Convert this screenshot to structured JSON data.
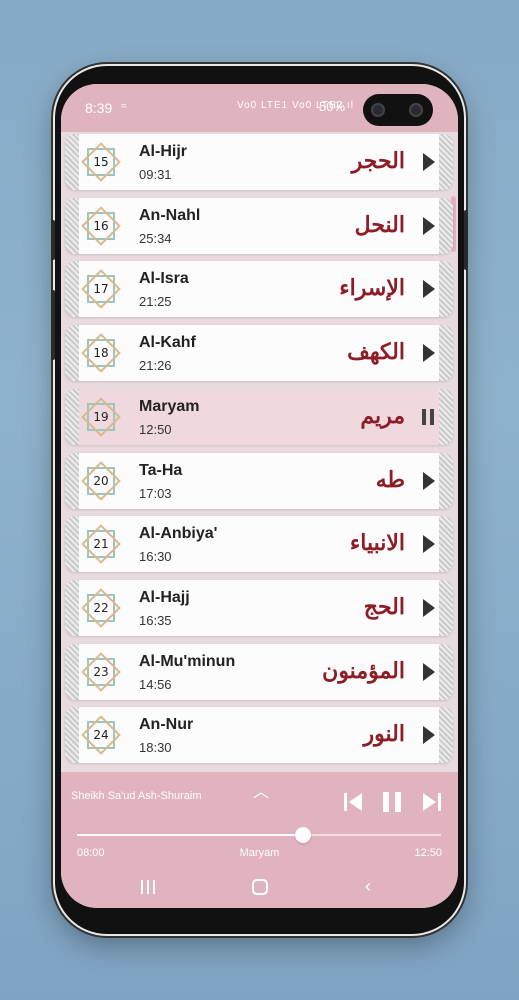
{
  "status": {
    "time": "8:39",
    "wifi_glyph": "≈",
    "signal": "Vo0 LTE1 Vo0 LTE2 ıl",
    "battery": "50%"
  },
  "surahs": [
    {
      "number": "15",
      "name": "Al-Hijr",
      "duration": "09:31",
      "arabic": "الحجر",
      "state": "play"
    },
    {
      "number": "16",
      "name": "An-Nahl",
      "duration": "25:34",
      "arabic": "النحل",
      "state": "play"
    },
    {
      "number": "17",
      "name": "Al-Isra",
      "duration": "21:25",
      "arabic": "الإسراء",
      "state": "play"
    },
    {
      "number": "18",
      "name": "Al-Kahf",
      "duration": "21:26",
      "arabic": "الكهف",
      "state": "play"
    },
    {
      "number": "19",
      "name": "Maryam",
      "duration": "12:50",
      "arabic": "مريم",
      "state": "pause"
    },
    {
      "number": "20",
      "name": "Ta-Ha",
      "duration": "17:03",
      "arabic": "طه",
      "state": "play"
    },
    {
      "number": "21",
      "name": "Al-Anbiya'",
      "duration": "16:30",
      "arabic": "الانبياء",
      "state": "play"
    },
    {
      "number": "22",
      "name": "Al-Hajj",
      "duration": "16:35",
      "arabic": "الحج",
      "state": "play"
    },
    {
      "number": "23",
      "name": "Al-Mu'minun",
      "duration": "14:56",
      "arabic": "المؤمنون",
      "state": "play"
    },
    {
      "number": "24",
      "name": "An-Nur",
      "duration": "18:30",
      "arabic": "النور",
      "state": "play"
    }
  ],
  "player": {
    "reciter": "Sheikh Sa'ud Ash-Shuraim",
    "elapsed": "08:00",
    "title": "Maryam",
    "total": "12:50",
    "progress": 0.62,
    "expand_icon": "chevron-up-icon"
  },
  "colors": {
    "accent": "#e0b3bf",
    "arabic_text": "#8d1d27",
    "active_row": "#f0d9de"
  }
}
